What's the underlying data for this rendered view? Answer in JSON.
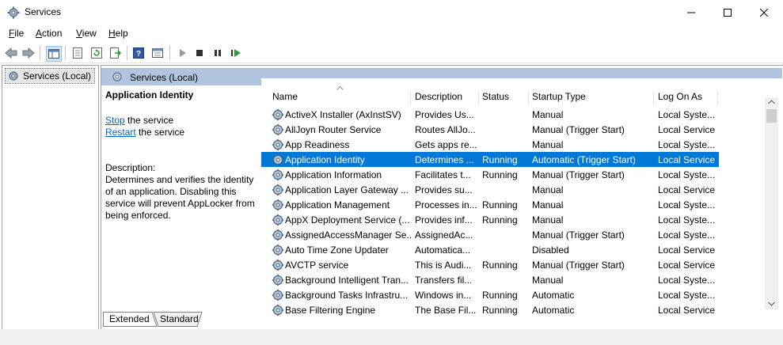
{
  "window": {
    "title": "Services"
  },
  "menu": {
    "items": [
      {
        "label": "File"
      },
      {
        "label": "Action"
      },
      {
        "label": "View"
      },
      {
        "label": "Help"
      }
    ]
  },
  "toolbar": {
    "icons": [
      "back-icon",
      "forward-icon",
      "show-hide-tree-icon",
      "properties-icon",
      "refresh-icon",
      "export-icon",
      "help-icon",
      "console-icon",
      "start-icon",
      "stop-icon",
      "pause-icon",
      "restart-icon"
    ]
  },
  "tree": {
    "root_label": "Services (Local)"
  },
  "pane": {
    "title": "Services (Local)"
  },
  "details": {
    "service_name": "Application Identity",
    "stop_link": "Stop",
    "stop_suffix": " the service",
    "restart_link": "Restart",
    "restart_suffix": " the service",
    "description_label": "Description:",
    "description_lines": [
      "Determines and verifies the identity",
      "of an application. Disabling this",
      "service will prevent AppLocker from",
      "being enforced."
    ]
  },
  "columns": [
    "Name",
    "Description",
    "Status",
    "Startup Type",
    "Log On As"
  ],
  "services": [
    {
      "name": "ActiveX Installer (AxInstSV)",
      "description": "Provides Us...",
      "status": "",
      "startup": "Manual",
      "logon": "Local Syste..."
    },
    {
      "name": "AllJoyn Router Service",
      "description": "Routes AllJo...",
      "status": "",
      "startup": "Manual (Trigger Start)",
      "logon": "Local Service"
    },
    {
      "name": "App Readiness",
      "description": "Gets apps re...",
      "status": "",
      "startup": "Manual",
      "logon": "Local Syste..."
    },
    {
      "name": "Application Identity",
      "description": "Determines ...",
      "status": "Running",
      "startup": "Automatic (Trigger Start)",
      "logon": "Local Service",
      "selected": true
    },
    {
      "name": "Application Information",
      "description": "Facilitates t...",
      "status": "Running",
      "startup": "Manual (Trigger Start)",
      "logon": "Local Syste..."
    },
    {
      "name": "Application Layer Gateway ...",
      "description": "Provides su...",
      "status": "",
      "startup": "Manual",
      "logon": "Local Service"
    },
    {
      "name": "Application Management",
      "description": "Processes in...",
      "status": "Running",
      "startup": "Manual",
      "logon": "Local Syste..."
    },
    {
      "name": "AppX Deployment Service (...",
      "description": "Provides inf...",
      "status": "Running",
      "startup": "Manual",
      "logon": "Local Syste..."
    },
    {
      "name": "AssignedAccessManager Se...",
      "description": "AssignedAc...",
      "status": "",
      "startup": "Manual (Trigger Start)",
      "logon": "Local Syste..."
    },
    {
      "name": "Auto Time Zone Updater",
      "description": "Automatica...",
      "status": "",
      "startup": "Disabled",
      "logon": "Local Service"
    },
    {
      "name": "AVCTP service",
      "description": "This is Audi...",
      "status": "Running",
      "startup": "Manual (Trigger Start)",
      "logon": "Local Service"
    },
    {
      "name": "Background Intelligent Tran...",
      "description": "Transfers fil...",
      "status": "",
      "startup": "Manual",
      "logon": "Local Syste..."
    },
    {
      "name": "Background Tasks Infrastru...",
      "description": "Windows in...",
      "status": "Running",
      "startup": "Automatic",
      "logon": "Local Syste..."
    },
    {
      "name": "Base Filtering Engine",
      "description": "The Base Fil...",
      "status": "Running",
      "startup": "Automatic",
      "logon": "Local Service"
    }
  ],
  "tabs": [
    {
      "label": "Extended",
      "active": true
    },
    {
      "label": "Standard",
      "active": false
    }
  ],
  "colors": {
    "selection": "#0078d7",
    "link": "#0066cc",
    "header": "#b0c4de"
  }
}
